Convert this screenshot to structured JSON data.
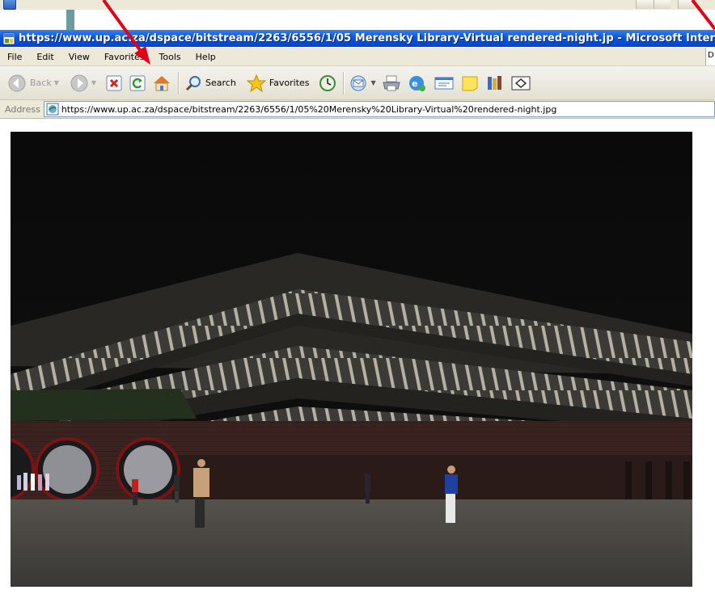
{
  "window": {
    "title": "https://www.up.ac.za/dspace/bitstream/2263/6556/1/05 Merensky Library-Virtual rendered-night.jp - Microsoft Internet E"
  },
  "menu": {
    "items": [
      "File",
      "Edit",
      "View",
      "Favorites",
      "Tools",
      "Help"
    ],
    "right_clip": "D"
  },
  "toolbar": {
    "back_label": "Back",
    "search_label": "Search",
    "favorites_label": "Favorites"
  },
  "address": {
    "label": "Address",
    "url": "https://www.up.ac.za/dspace/bitstream/2263/6556/1/05%20Merensky%20Library-Virtual%20rendered-night.jpg"
  },
  "icons": {
    "back": "back-arrow-icon",
    "forward": "forward-arrow-icon",
    "stop": "stop-icon",
    "refresh": "refresh-icon",
    "home": "home-icon",
    "search": "magnifier-icon",
    "favorites": "star-icon",
    "history": "history-icon",
    "mail": "mail-icon",
    "print": "printer-icon",
    "edit": "edit-icon",
    "discuss": "discuss-icon",
    "messenger": "note-icon",
    "research": "research-icon",
    "fullscreen": "fullscreen-icon"
  },
  "colors": {
    "titlebar": "#0a56e0",
    "annotation_arrow": "#e0001a"
  }
}
